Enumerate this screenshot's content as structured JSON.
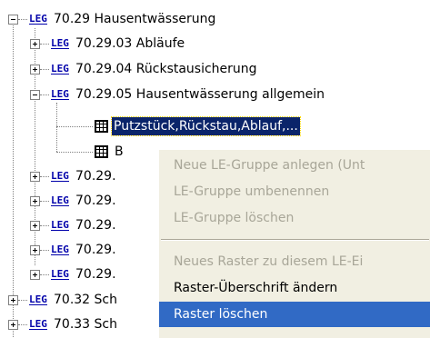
{
  "tree": {
    "leg_badge": "LEG",
    "items": [
      {
        "label": "70.29  Hausentwässerung"
      },
      {
        "label": "70.29.03  Abläufe"
      },
      {
        "label": "70.29.04  Rückstausicherung"
      },
      {
        "label": "70.29.05  Hausentwässerung allgemein"
      },
      {
        "label": "Putzstück,Rückstau,Ablauf,..."
      },
      {
        "label": "B"
      },
      {
        "label": "70.29."
      },
      {
        "label": "70.29."
      },
      {
        "label": "70.29."
      },
      {
        "label": "70.29."
      },
      {
        "label": "70.29."
      },
      {
        "label": "70.32  Sch"
      },
      {
        "label": "70.33  Sch"
      }
    ]
  },
  "context_menu": {
    "items": [
      {
        "label": "Neue LE-Gruppe anlegen (Unt",
        "enabled": false
      },
      {
        "label": "LE-Gruppe umbenennen",
        "enabled": false
      },
      {
        "label": "LE-Gruppe löschen",
        "enabled": false
      },
      {
        "label": "Neues Raster zu diesem LE-Ei",
        "enabled": false
      },
      {
        "label": "Raster-Überschrift ändern",
        "enabled": true
      },
      {
        "label": "Raster löschen",
        "enabled": true,
        "highlighted": true
      }
    ]
  },
  "colors": {
    "selection": "#0a246a",
    "menu_highlight": "#316ac5",
    "menu_background": "#f1efe2",
    "disabled_text": "#a8a698",
    "leg_badge": "#0000aa"
  }
}
